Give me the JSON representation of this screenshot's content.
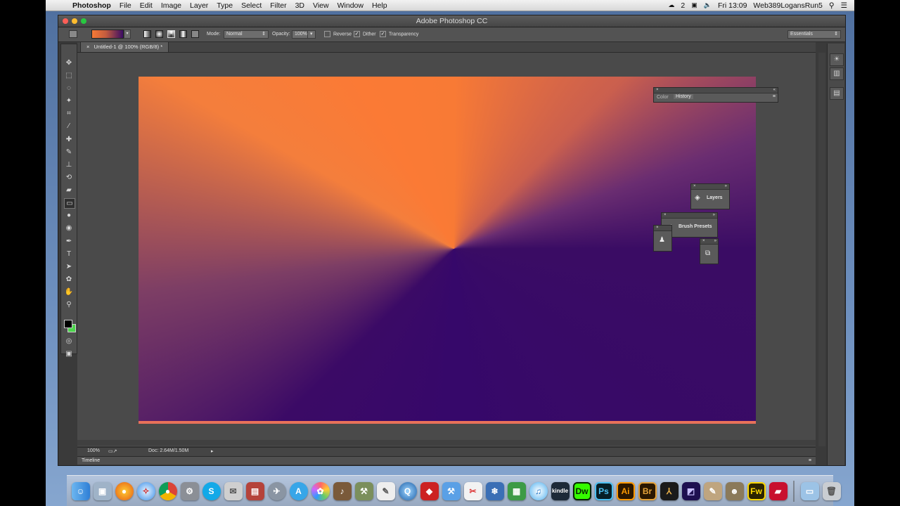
{
  "menubar": {
    "apple": "",
    "app_name": "Photoshop",
    "items": [
      "File",
      "Edit",
      "Image",
      "Layer",
      "Type",
      "Select",
      "Filter",
      "3D",
      "View",
      "Window",
      "Help"
    ],
    "badge": "2",
    "clock": "Fri 13:09",
    "user": "Web389LogansRun5"
  },
  "window": {
    "title": "Adobe Photoshop CC"
  },
  "options": {
    "mode_label": "Mode:",
    "mode_value": "Normal",
    "opacity_label": "Opacity:",
    "opacity_value": "100%",
    "reverse_label": "Reverse",
    "dither_label": "Dither",
    "transparency_label": "Transparency",
    "dither_checked": true,
    "transparency_checked": true,
    "workspace": "Essentials"
  },
  "document": {
    "tab": "Untitled-1 @ 100% (RGB/8) *"
  },
  "status": {
    "zoom": "100%",
    "doc": "Doc: 2.64M/1.50M"
  },
  "timeline": {
    "label": "Timeline"
  },
  "panels": {
    "color_tab": "Color",
    "history_tab": "History",
    "layers": "Layers",
    "brush_presets": "Brush Presets"
  },
  "gradient": {
    "start": "#f87a35",
    "end": "#3a0c64"
  },
  "dock": {
    "kindle": "kindle",
    "dw": "Dw",
    "ps": "Ps",
    "ai": "Ai",
    "br": "Br",
    "fw": "Fw"
  }
}
